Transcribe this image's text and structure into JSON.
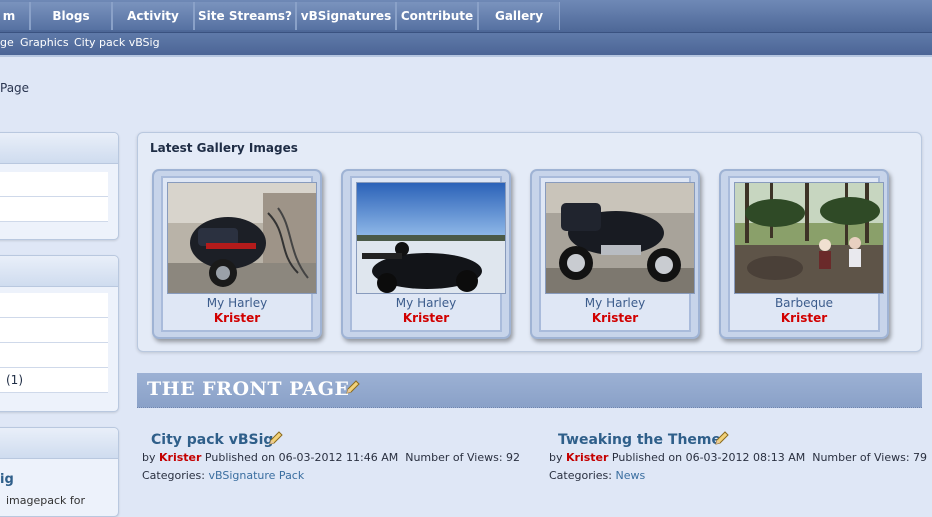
{
  "nav": {
    "tabs": [
      "m",
      "Blogs",
      "Activity",
      "Site Streams?",
      "vBSignatures",
      "Contribute",
      "Gallery"
    ]
  },
  "subnav": {
    "links": [
      "ge",
      "Graphics",
      "City pack vBSig"
    ]
  },
  "breadcrumb": "Page",
  "sidebar": {
    "count_row": "(1)",
    "link": "ig",
    "snippet": "imagepack for"
  },
  "gallery": {
    "title": "Latest Gallery Images",
    "items": [
      {
        "title": "My Harley",
        "author": "Krister"
      },
      {
        "title": "My Harley",
        "author": "Krister"
      },
      {
        "title": "My Harley",
        "author": "Krister"
      },
      {
        "title": "Barbeque",
        "author": "Krister"
      }
    ]
  },
  "front_page": {
    "title": "THE FRONT PAGE",
    "articles": [
      {
        "title": "City pack vBSig",
        "by": "by",
        "author": "Krister",
        "published": "Published on 06-03-2012 11:46 AM",
        "views": "Number of Views: 92",
        "categories_label": "Categories:",
        "category": "vBSignature Pack"
      },
      {
        "title": "Tweaking the Theme",
        "by": "by",
        "author": "Krister",
        "published": "Published on 06-03-2012 08:13 AM",
        "views": "Number of Views: 79",
        "categories_label": "Categories:",
        "category": "News"
      }
    ]
  },
  "icons": {
    "edit": "pencil-icon"
  },
  "colors": {
    "nav_bg": "#5671a2",
    "author_red": "#d10000",
    "link_blue": "#2f5f8a",
    "page_bg": "#dfe7f6"
  }
}
